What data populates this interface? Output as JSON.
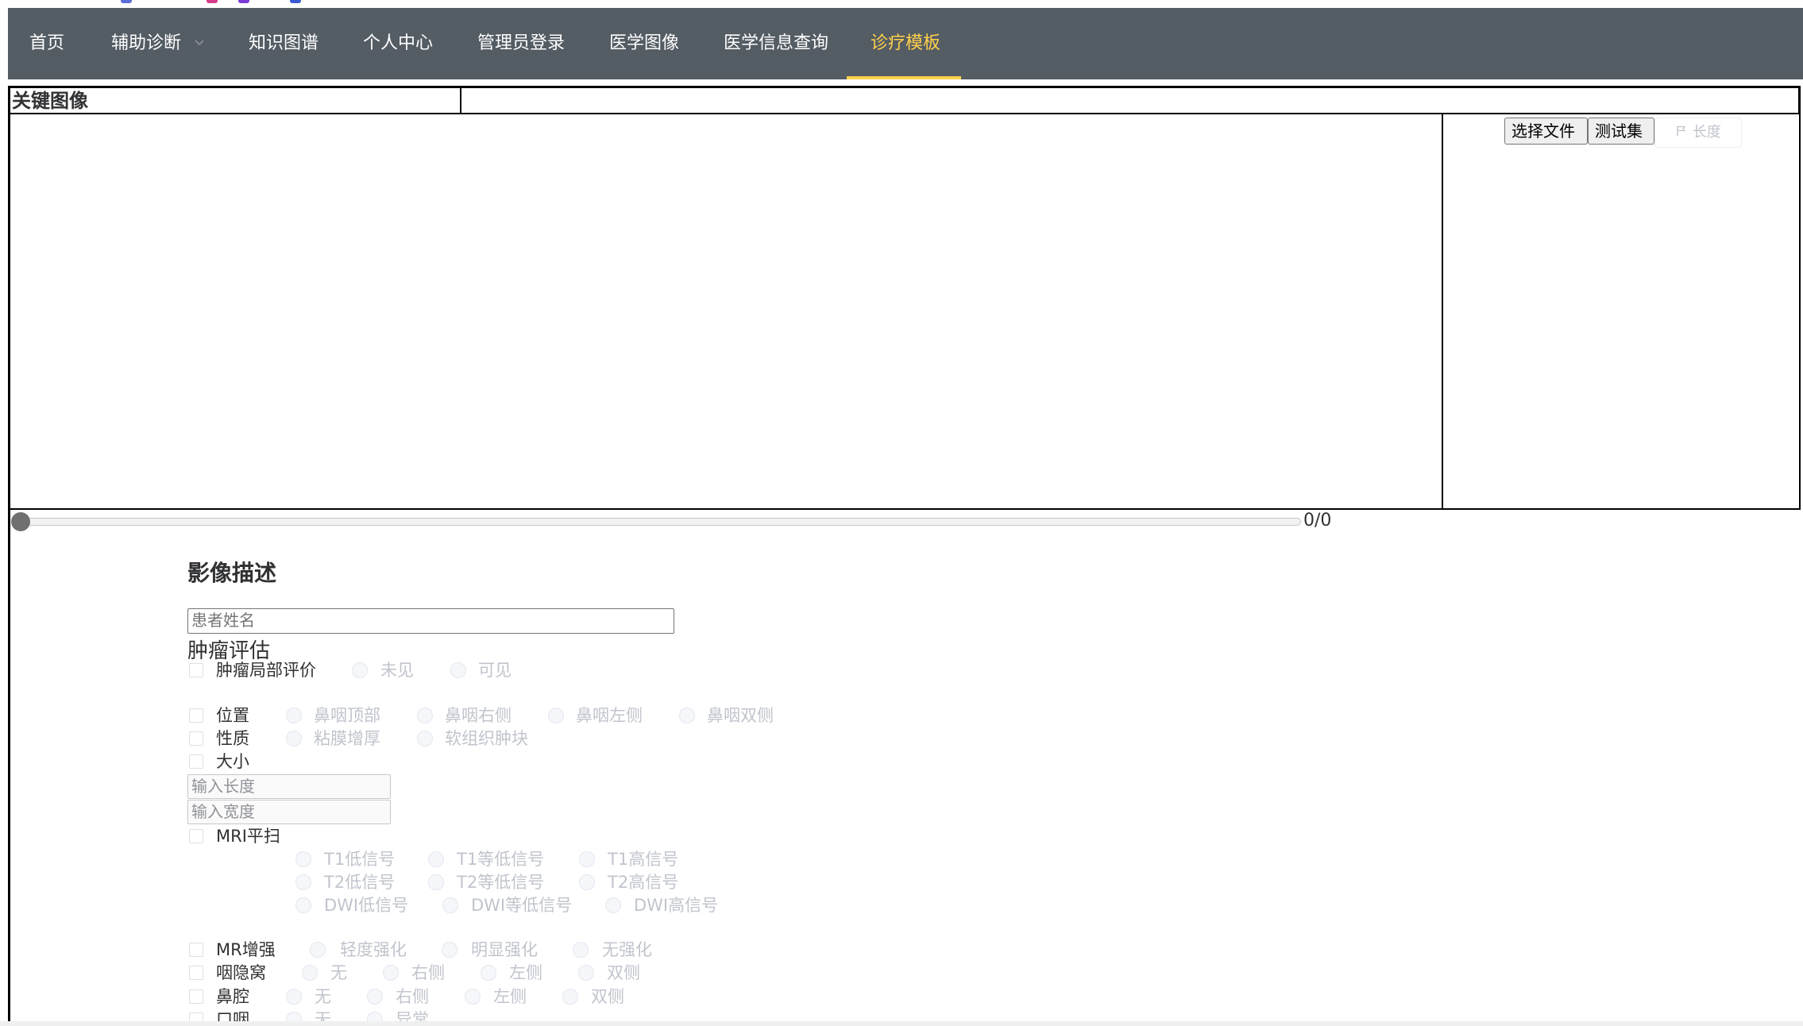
{
  "nav": {
    "items": [
      {
        "label": "首页"
      },
      {
        "label": "辅助诊断"
      },
      {
        "label": "知识图谱"
      },
      {
        "label": "个人中心"
      },
      {
        "label": "管理员登录"
      },
      {
        "label": "医学图像"
      },
      {
        "label": "医学信息查询"
      },
      {
        "label": "诊疗模板"
      }
    ],
    "active_index": 7
  },
  "colors": {
    "nav_bg": "#545c64",
    "nav_active": "#ffd04b",
    "disabled_text": "#c0c4cc"
  },
  "section": {
    "title": "关键图像"
  },
  "side_panel": {
    "choose_file": "选择文件",
    "test_set": "测试集",
    "length_label": "长度",
    "length_icon": "flag-icon"
  },
  "slider": {
    "counter": "0/0",
    "value": 0
  },
  "form": {
    "title": "影像描述",
    "patient_name_placeholder": "患者姓名",
    "group_title": "肿瘤评估",
    "local_eval": {
      "label": "肿瘤局部评价",
      "options": [
        "未见",
        "可见"
      ]
    },
    "position": {
      "label": "位置",
      "options": [
        "鼻咽顶部",
        "鼻咽右侧",
        "鼻咽左侧",
        "鼻咽双侧"
      ]
    },
    "nature": {
      "label": "性质",
      "options": [
        "粘膜增厚",
        "软组织肿块"
      ]
    },
    "size": {
      "label": "大小",
      "length_placeholder": "输入长度",
      "width_placeholder": "输入宽度"
    },
    "mri": {
      "label": "MRI平扫",
      "t1": [
        "T1低信号",
        "T1等低信号",
        "T1高信号"
      ],
      "t2": [
        "T2低信号",
        "T2等低信号",
        "T2高信号"
      ],
      "dwi": [
        "DWI低信号",
        "DWI等低信号",
        "DWI高信号"
      ]
    },
    "mr_enhance": {
      "label": "MR增强",
      "options": [
        "轻度强化",
        "明显强化",
        "无强化"
      ]
    },
    "pharyngeal_recess": {
      "label": "咽隐窝",
      "options": [
        "无",
        "右侧",
        "左侧",
        "双侧"
      ]
    },
    "nasal_cavity": {
      "label": "鼻腔",
      "options": [
        "无",
        "右侧",
        "左侧",
        "双侧"
      ]
    },
    "oropharynx": {
      "label": "口咽",
      "options": [
        "无",
        "异常"
      ]
    }
  }
}
